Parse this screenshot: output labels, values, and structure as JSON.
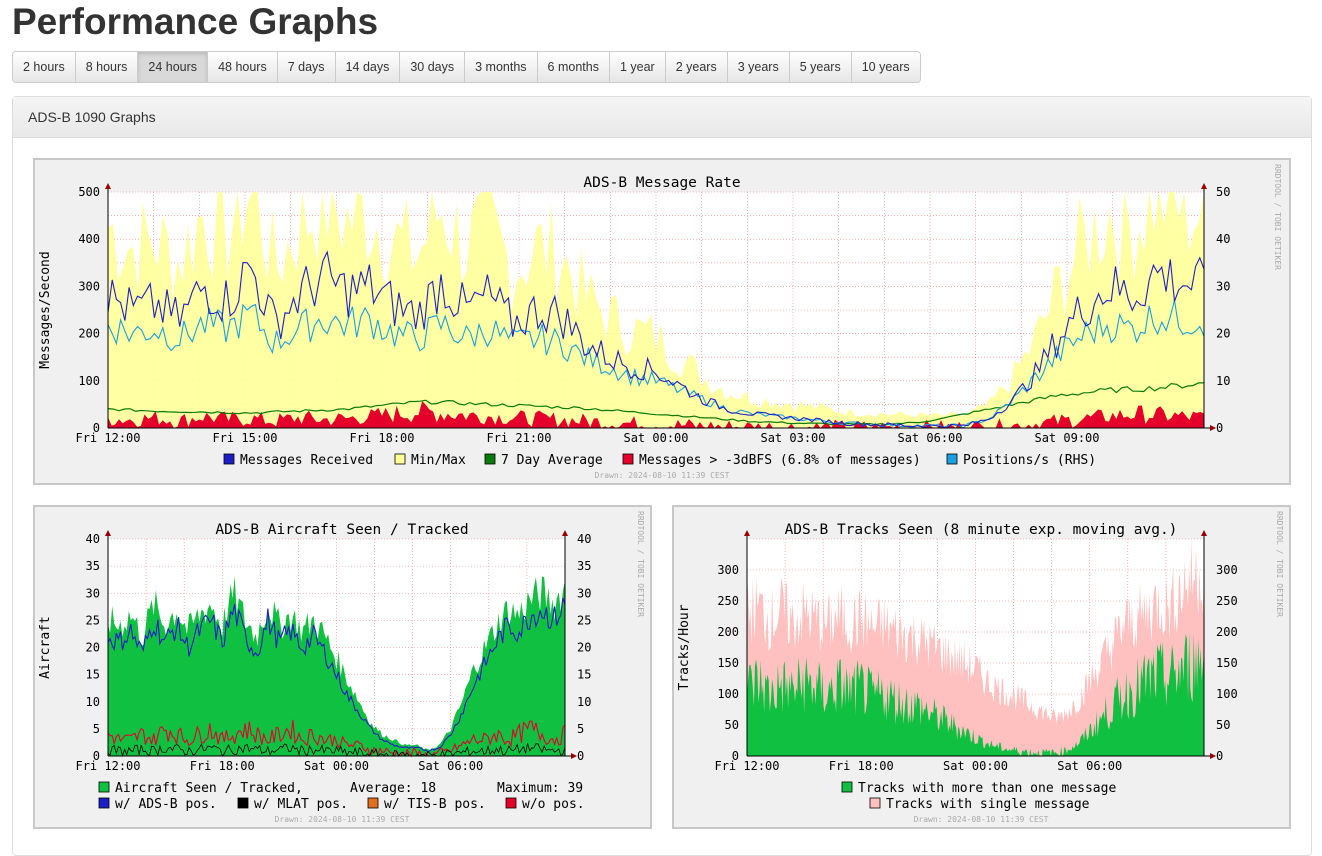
{
  "page": {
    "title": "Performance Graphs",
    "ranges": [
      "2 hours",
      "8 hours",
      "24 hours",
      "48 hours",
      "7 days",
      "14 days",
      "30 days",
      "3 months",
      "6 months",
      "1 year",
      "2 years",
      "3 years",
      "5 years",
      "10 years"
    ],
    "active_range": "24 hours"
  },
  "panel": {
    "heading": "ADS-B 1090 Graphs"
  },
  "watermark": "RRDTOOL / TOBI OETIKER",
  "drawn": "Drawn: 2024-08-10 11:39 CEST",
  "colors": {
    "messages_received": "#1d1dc7",
    "minmax": "#ffff99",
    "seven_day": "#0a7a0a",
    "strong": "#e5002b",
    "positions": "#1a9fe0",
    "aircraft": "#10c040",
    "single": "#ffc0c0"
  },
  "chart_data": [
    {
      "type": "line",
      "title": "ADS-B Message Rate",
      "ylabel": "Messages/Second",
      "ylim": [
        0,
        500
      ],
      "y_ticks": [
        "500",
        "400",
        "300",
        "200",
        "100",
        "0"
      ],
      "y2_ticks": [
        "50",
        "40",
        "30",
        "20",
        "10",
        "0"
      ],
      "x_ticks": [
        "Fri 12:00",
        "Fri 15:00",
        "Fri 18:00",
        "Fri 21:00",
        "Sat 00:00",
        "Sat 03:00",
        "Sat 06:00",
        "Sat 09:00"
      ],
      "legend": [
        "Messages Received",
        "Min/Max",
        "7 Day Average",
        "Messages > -3dBFS (6.8% of messages)",
        "Positions/s (RHS)"
      ],
      "series": [
        {
          "name": "Messages Received",
          "values": [
            280,
            250,
            260,
            230,
            300,
            270,
            340,
            220,
            280,
            320,
            290,
            300,
            260,
            240,
            310,
            250,
            280,
            220,
            250,
            240,
            180,
            150,
            130,
            120,
            90,
            60,
            40,
            30,
            25,
            20,
            15,
            10,
            8,
            6,
            5,
            4,
            5,
            20,
            60,
            120,
            200,
            260,
            300,
            280,
            330,
            310,
            300
          ]
        },
        {
          "name": "7 Day Average",
          "values": [
            40,
            38,
            36,
            35,
            34,
            33,
            32,
            34,
            36,
            38,
            40,
            45,
            50,
            55,
            55,
            52,
            50,
            48,
            46,
            44,
            42,
            38,
            34,
            30,
            26,
            22,
            18,
            14,
            12,
            10,
            9,
            8,
            8,
            9,
            12,
            20,
            30,
            40,
            50,
            60,
            70,
            75,
            80,
            82,
            85,
            90,
            95
          ]
        },
        {
          "name": "Positions/s (RHS)",
          "values": [
            22,
            20,
            21,
            19,
            22,
            21,
            24,
            18,
            21,
            23,
            22,
            23,
            20,
            19,
            22,
            19,
            21,
            18,
            19,
            18,
            15,
            13,
            11,
            10,
            8,
            6,
            4,
            3,
            2.5,
            2,
            1.5,
            1,
            0.8,
            0.6,
            0.5,
            0.4,
            0.5,
            2,
            6,
            11,
            16,
            20,
            22,
            21,
            24,
            23,
            23
          ]
        },
        {
          "name": "Messages > -3dBFS",
          "values": [
            20,
            18,
            22,
            15,
            25,
            18,
            20,
            15,
            22,
            18,
            20,
            25,
            30,
            35,
            32,
            28,
            25,
            22,
            20,
            18,
            15,
            12,
            10,
            8,
            6,
            4,
            3,
            2,
            2,
            1,
            1,
            1,
            1,
            1,
            1,
            1,
            1,
            2,
            5,
            10,
            15,
            20,
            25,
            30,
            28,
            25,
            22
          ]
        }
      ]
    },
    {
      "type": "area",
      "title": "ADS-B Aircraft Seen / Tracked",
      "ylabel": "Aircraft",
      "ylim": [
        0,
        40
      ],
      "y_ticks": [
        "40",
        "35",
        "30",
        "25",
        "20",
        "15",
        "10",
        "5",
        "0"
      ],
      "x_ticks": [
        "Fri 12:00",
        "Fri 18:00",
        "Sat 00:00",
        "Sat 06:00"
      ],
      "legend": [
        "Aircraft Seen / Tracked,",
        "Average: 18",
        "Maximum: 39",
        "w/ ADS-B pos.",
        "w/ MLAT pos.",
        "w/ TIS-B pos.",
        "w/o pos."
      ],
      "series": [
        {
          "name": "Aircraft Seen / Tracked",
          "values": [
            25,
            24,
            26,
            22,
            28,
            24,
            27,
            23,
            26,
            28,
            24,
            30,
            25,
            22,
            28,
            24,
            26,
            23,
            25,
            22,
            18,
            14,
            10,
            6,
            4,
            3,
            2,
            2,
            1,
            2,
            5,
            10,
            16,
            20,
            24,
            27,
            26,
            29,
            30,
            28,
            31
          ]
        },
        {
          "name": "w/ ADS-B pos.",
          "values": [
            22,
            21,
            23,
            19,
            25,
            21,
            24,
            20,
            23,
            25,
            21,
            27,
            22,
            19,
            25,
            21,
            23,
            20,
            22,
            19,
            15,
            11,
            8,
            5,
            3,
            2,
            1.5,
            1.5,
            1,
            1.5,
            4,
            8,
            13,
            17,
            21,
            24,
            23,
            26,
            27,
            25,
            28
          ]
        },
        {
          "name": "w/o pos.",
          "values": [
            4,
            3,
            3,
            4,
            3,
            5,
            4,
            3,
            4,
            5,
            3,
            4,
            5,
            4,
            3,
            4,
            5,
            3,
            4,
            3,
            3,
            2,
            2,
            1,
            1,
            0.5,
            0.5,
            0.5,
            0,
            0.5,
            1,
            2,
            3,
            3,
            4,
            3,
            4,
            5,
            4,
            3,
            4
          ]
        }
      ]
    },
    {
      "type": "area",
      "title": "ADS-B Tracks Seen (8 minute exp. moving avg.)",
      "ylabel": "Tracks/Hour",
      "ylim": [
        0,
        350
      ],
      "y_ticks": [
        "300",
        "250",
        "200",
        "150",
        "100",
        "50",
        "0"
      ],
      "x_ticks": [
        "Fri 12:00",
        "Fri 18:00",
        "Sat 00:00",
        "Sat 06:00"
      ],
      "legend": [
        "Tracks with more than one message",
        "Tracks with single message"
      ],
      "series": [
        {
          "name": "Tracks with more than one message",
          "values": [
            110,
            120,
            100,
            115,
            105,
            120,
            110,
            100,
            115,
            105,
            110,
            95,
            100,
            90,
            85,
            80,
            70,
            60,
            50,
            40,
            30,
            20,
            15,
            10,
            8,
            6,
            5,
            5,
            10,
            20,
            40,
            60,
            80,
            100,
            110,
            120,
            130,
            125,
            140,
            150,
            160
          ]
        },
        {
          "name": "Tracks with single message",
          "values": [
            230,
            240,
            220,
            235,
            215,
            230,
            220,
            210,
            225,
            215,
            220,
            205,
            210,
            200,
            195,
            190,
            180,
            170,
            160,
            150,
            140,
            120,
            110,
            100,
            90,
            80,
            70,
            60,
            70,
            90,
            120,
            150,
            180,
            210,
            220,
            230,
            250,
            240,
            270,
            290,
            300
          ]
        }
      ]
    }
  ]
}
